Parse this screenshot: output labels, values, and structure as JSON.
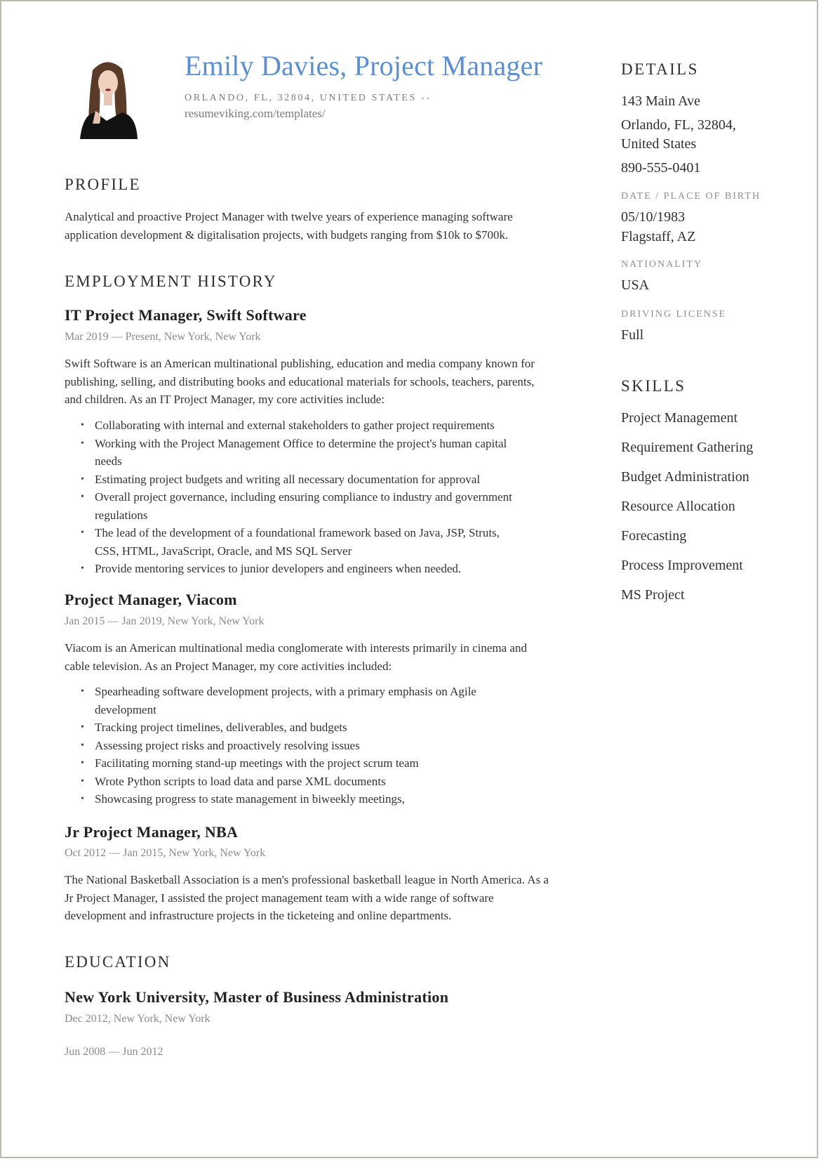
{
  "header": {
    "name": "Emily Davies, Project Manager",
    "address": "ORLANDO, FL, 32804, UNITED STATES  --",
    "link": "resumeviking.com/templates/",
    "accent_color": "#5b8fd1"
  },
  "profile": {
    "title": "PROFILE",
    "text": "Analytical and proactive Project Manager with twelve years of experience managing software application development & digitalisation projects, with budgets ranging from $10k to $700k."
  },
  "employment": {
    "title": "EMPLOYMENT HISTORY",
    "jobs": [
      {
        "title": "IT Project Manager, Swift Software",
        "meta": "Mar 2019 — Present, New York, New York",
        "description": "Swift Software is an American multinational publishing, education and media company known for publishing, selling, and distributing books and educational materials for schools, teachers, parents, and children. As an IT Project Manager, my core activities include:",
        "bullets": [
          "Collaborating with internal and external stakeholders to gather project requirements",
          "Working with the Project Management Office to determine the project's human capital needs",
          "Estimating project budgets and writing all necessary documentation for approval",
          "Overall project governance, including ensuring compliance to industry and government regulations",
          "The lead of the development of a foundational framework based on Java, JSP, Struts, CSS, HTML, JavaScript, Oracle, and MS SQL Server",
          "Provide mentoring services to junior developers and engineers when needed."
        ]
      },
      {
        "title": "Project Manager, Viacom",
        "meta": "Jan 2015 — Jan 2019, New York, New York",
        "description": "Viacom is an American multinational media conglomerate with interests primarily in cinema and cable television. As an Project Manager, my core activities included:",
        "bullets": [
          "Spearheading software development projects, with a primary emphasis on Agile development",
          "Tracking project timelines, deliverables, and budgets",
          "Assessing project risks and proactively resolving issues",
          "Facilitating morning stand-up meetings with the project scrum team",
          "Wrote Python scripts to load data and parse XML documents",
          "Showcasing progress to state management in biweekly meetings,"
        ]
      },
      {
        "title": "Jr Project Manager, NBA",
        "meta": "Oct 2012 — Jan 2015, New York, New York",
        "description": "The National Basketball Association is a men's professional basketball league in North America. As a Jr Project Manager, I assisted the project management team with a wide range of software development and infrastructure projects in the ticketeing and online departments."
      }
    ]
  },
  "education": {
    "title": "EDUCATION",
    "entries": [
      {
        "title": "New York University, Master of Business Administration",
        "meta": "Dec 2012, New York, New York",
        "dates": "Jun 2008 — Jun 2012"
      }
    ]
  },
  "details": {
    "title": "DETAILS",
    "address_line1": "143 Main Ave",
    "address_line2": "Orlando, FL, 32804,",
    "address_line3": "United States",
    "phone": "890-555-0401",
    "birth_label": "DATE / PLACE OF BIRTH",
    "birth_date": "05/10/1983",
    "birth_place": "Flagstaff, AZ",
    "nationality_label": "NATIONALITY",
    "nationality": "USA",
    "license_label": "DRIVING LICENSE",
    "license": "Full"
  },
  "skills": {
    "title": "SKILLS",
    "items": [
      "Project Management",
      "Requirement Gathering",
      "Budget Administration",
      "Resource Allocation",
      "Forecasting",
      "Process Improvement",
      "MS Project"
    ]
  }
}
